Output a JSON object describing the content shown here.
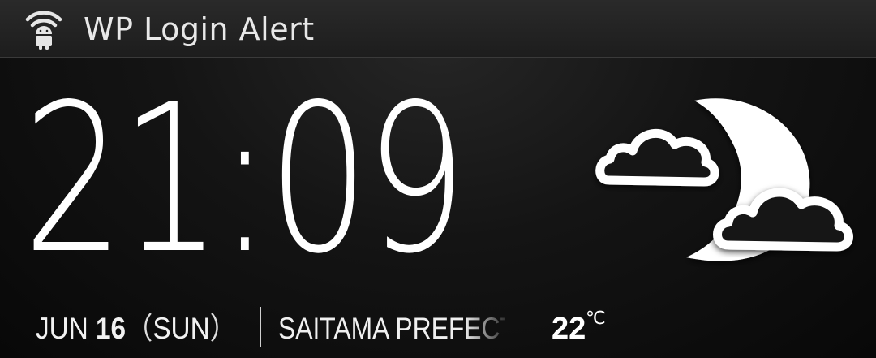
{
  "titlebar": {
    "app_icon": "wifi-android-icon",
    "title": "WP Login Alert"
  },
  "clock": {
    "time": "21:09"
  },
  "weather": {
    "icon": "night-cloudy-icon",
    "temperature": "22",
    "unit": "℃",
    "location": "SAITAMA PREFECTU"
  },
  "date": {
    "month": "JUN",
    "day": "16",
    "open_paren": "（",
    "weekday": "SUN",
    "close_paren": "）"
  },
  "colors": {
    "background": "#141414",
    "text": "#ffffff",
    "titlebar": "#222222"
  }
}
